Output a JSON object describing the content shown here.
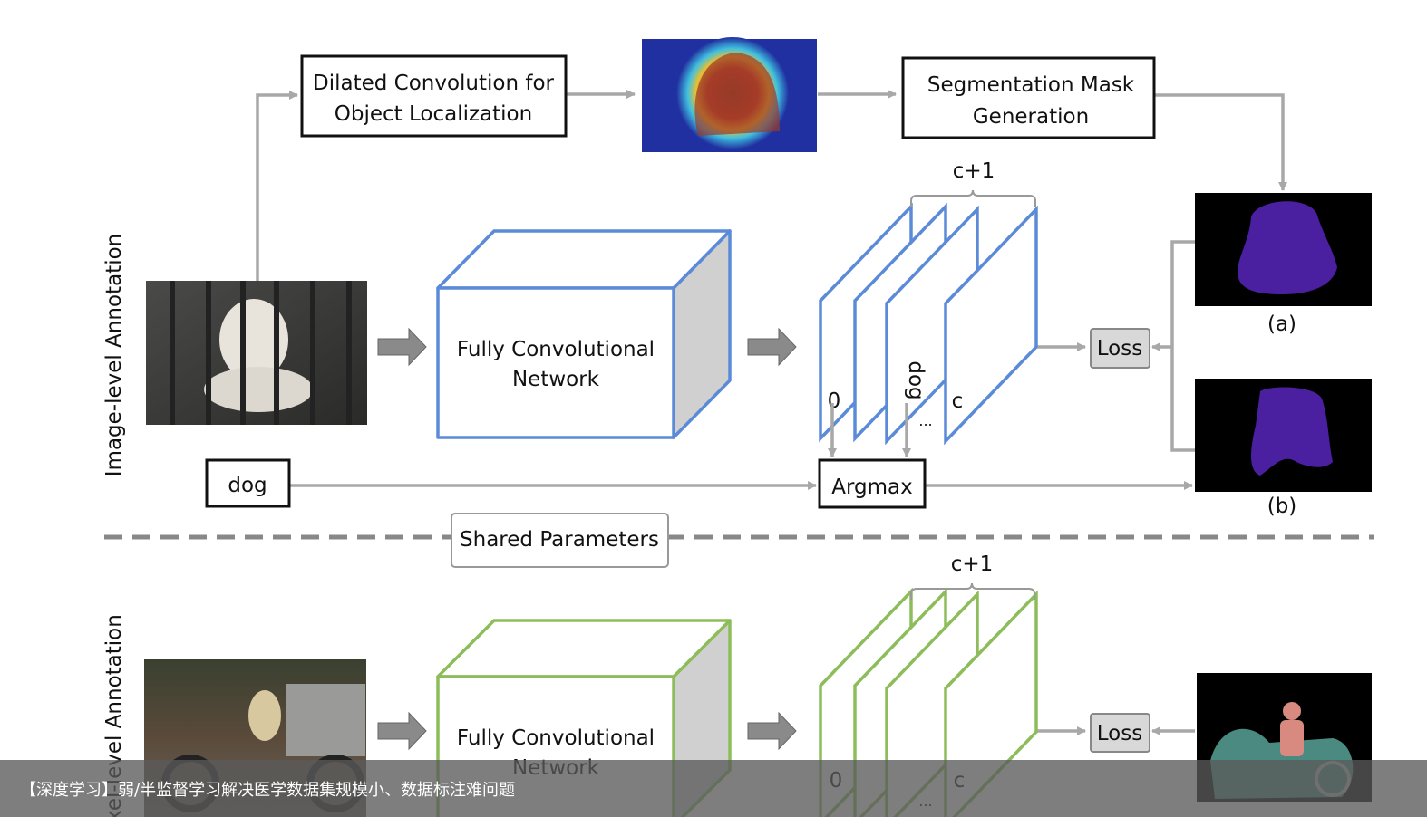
{
  "diagram": {
    "top_section_label": "Image-level Annotation",
    "bottom_section_label": "Pixel-level Annotation",
    "dilated_box": [
      "Dilated Convolution for",
      "Object Localization"
    ],
    "segmentation_box": [
      "Segmentation Mask",
      "Generation"
    ],
    "fcn_label": [
      "Fully Convolutional",
      "Network"
    ],
    "channels_label": "c+1",
    "plane_labels": {
      "first": "0",
      "dog": "dog",
      "ellipsis": "...",
      "last": "c"
    },
    "loss_label": "Loss",
    "argmax_label": "Argmax",
    "image_label": "dog",
    "shared_params": "Shared Parameters",
    "mask_a_label": "(a)",
    "mask_b_label": "(b)",
    "colors": {
      "top_network": "#5b8bd8",
      "bottom_network": "#8dbd5a",
      "arrow": "#a8a8a8",
      "mask": "#4a1fa0"
    }
  },
  "caption": "【深度学习】弱/半监督学习解决医学数据集规模小、数据标注难问题"
}
